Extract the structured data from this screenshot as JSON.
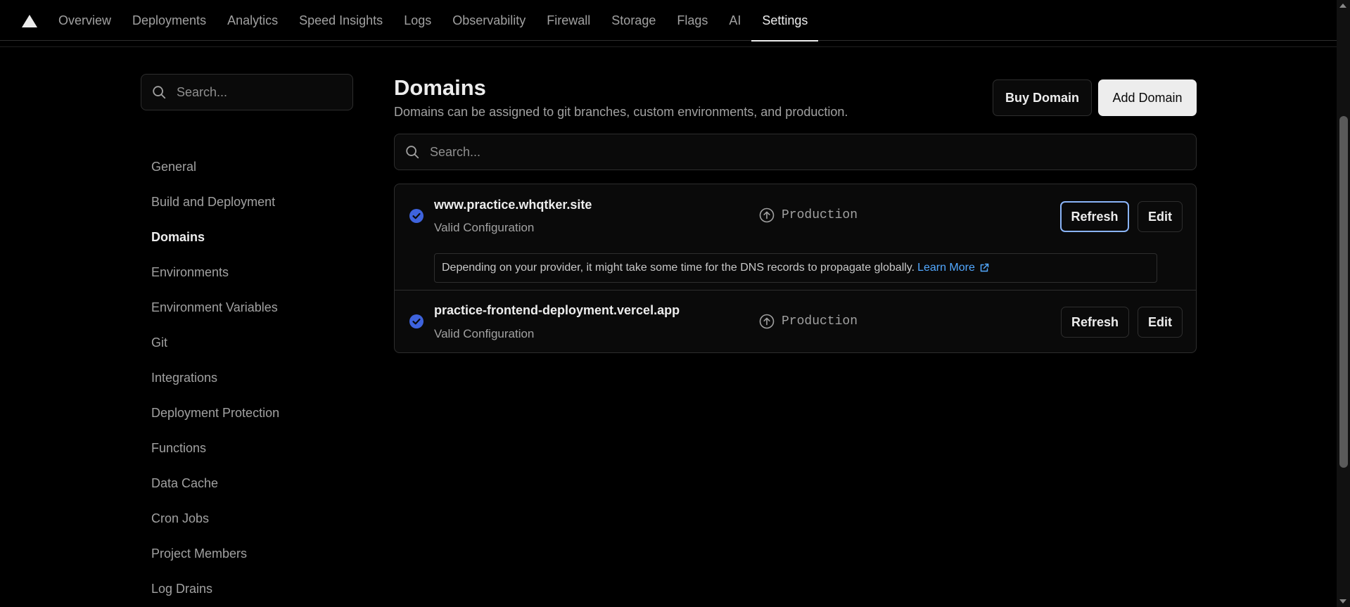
{
  "nav": {
    "tabs": [
      {
        "label": "Overview"
      },
      {
        "label": "Deployments"
      },
      {
        "label": "Analytics"
      },
      {
        "label": "Speed Insights"
      },
      {
        "label": "Logs"
      },
      {
        "label": "Observability"
      },
      {
        "label": "Firewall"
      },
      {
        "label": "Storage"
      },
      {
        "label": "Flags"
      },
      {
        "label": "AI"
      },
      {
        "label": "Settings"
      }
    ],
    "active_tab": "Settings"
  },
  "sidebar": {
    "search_placeholder": "Search...",
    "items": [
      {
        "label": "General"
      },
      {
        "label": "Build and Deployment"
      },
      {
        "label": "Domains"
      },
      {
        "label": "Environments"
      },
      {
        "label": "Environment Variables"
      },
      {
        "label": "Git"
      },
      {
        "label": "Integrations"
      },
      {
        "label": "Deployment Protection"
      },
      {
        "label": "Functions"
      },
      {
        "label": "Data Cache"
      },
      {
        "label": "Cron Jobs"
      },
      {
        "label": "Project Members"
      },
      {
        "label": "Log Drains"
      }
    ],
    "active_item": "Domains"
  },
  "main": {
    "title": "Domains",
    "subtitle": "Domains can be assigned to git branches, custom environments, and production.",
    "buy_domain_label": "Buy Domain",
    "add_domain_label": "Add Domain",
    "search_placeholder": "Search...",
    "domains": [
      {
        "name": "www.practice.whqtker.site",
        "status": "Valid Configuration",
        "environment": "Production",
        "refresh_label": "Refresh",
        "edit_label": "Edit",
        "notice": "Depending on your provider, it might take some time for the DNS records to propagate globally.",
        "notice_link": "Learn More"
      },
      {
        "name": "practice-frontend-deployment.vercel.app",
        "status": "Valid Configuration",
        "environment": "Production",
        "refresh_label": "Refresh",
        "edit_label": "Edit"
      }
    ]
  },
  "colors": {
    "background": "#000000",
    "accent_blue": "#52a8ff",
    "check_blue": "#3e63dd",
    "focus_ring": "#8ab4f8"
  },
  "icons": {
    "logo": "vercel-triangle-icon",
    "search": "search-icon",
    "check": "check-circle-icon",
    "environment": "arrow-up-circle-icon",
    "external": "external-link-icon"
  }
}
